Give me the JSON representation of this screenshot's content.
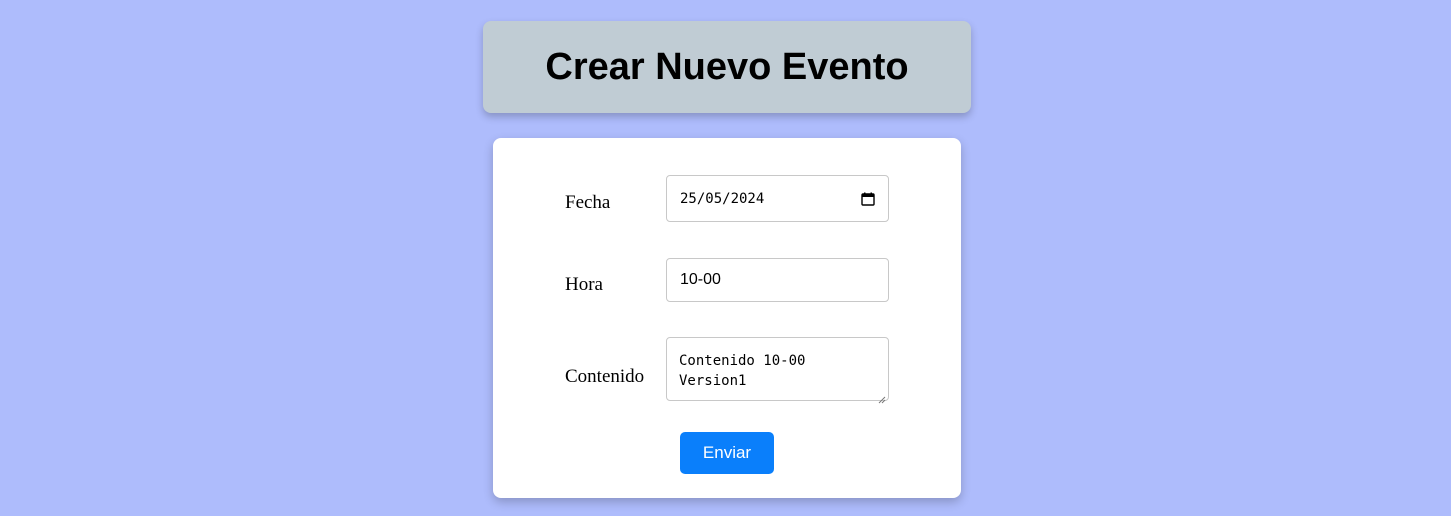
{
  "header": {
    "title": "Crear Nuevo Evento"
  },
  "form": {
    "fecha": {
      "label": "Fecha",
      "value": "25/05/2024",
      "icon": "calendar-icon"
    },
    "hora": {
      "label": "Hora",
      "value": "10-00"
    },
    "contenido": {
      "label": "Contenido",
      "line1": "Contenido 10-00",
      "line2": "Version1"
    },
    "submit_label": "Enviar"
  },
  "colors": {
    "background": "#aebcfc",
    "header_bg": "#c0ccd4",
    "card_bg": "#ffffff",
    "button_bg": "#0a7ffb",
    "button_text": "#ffffff"
  }
}
